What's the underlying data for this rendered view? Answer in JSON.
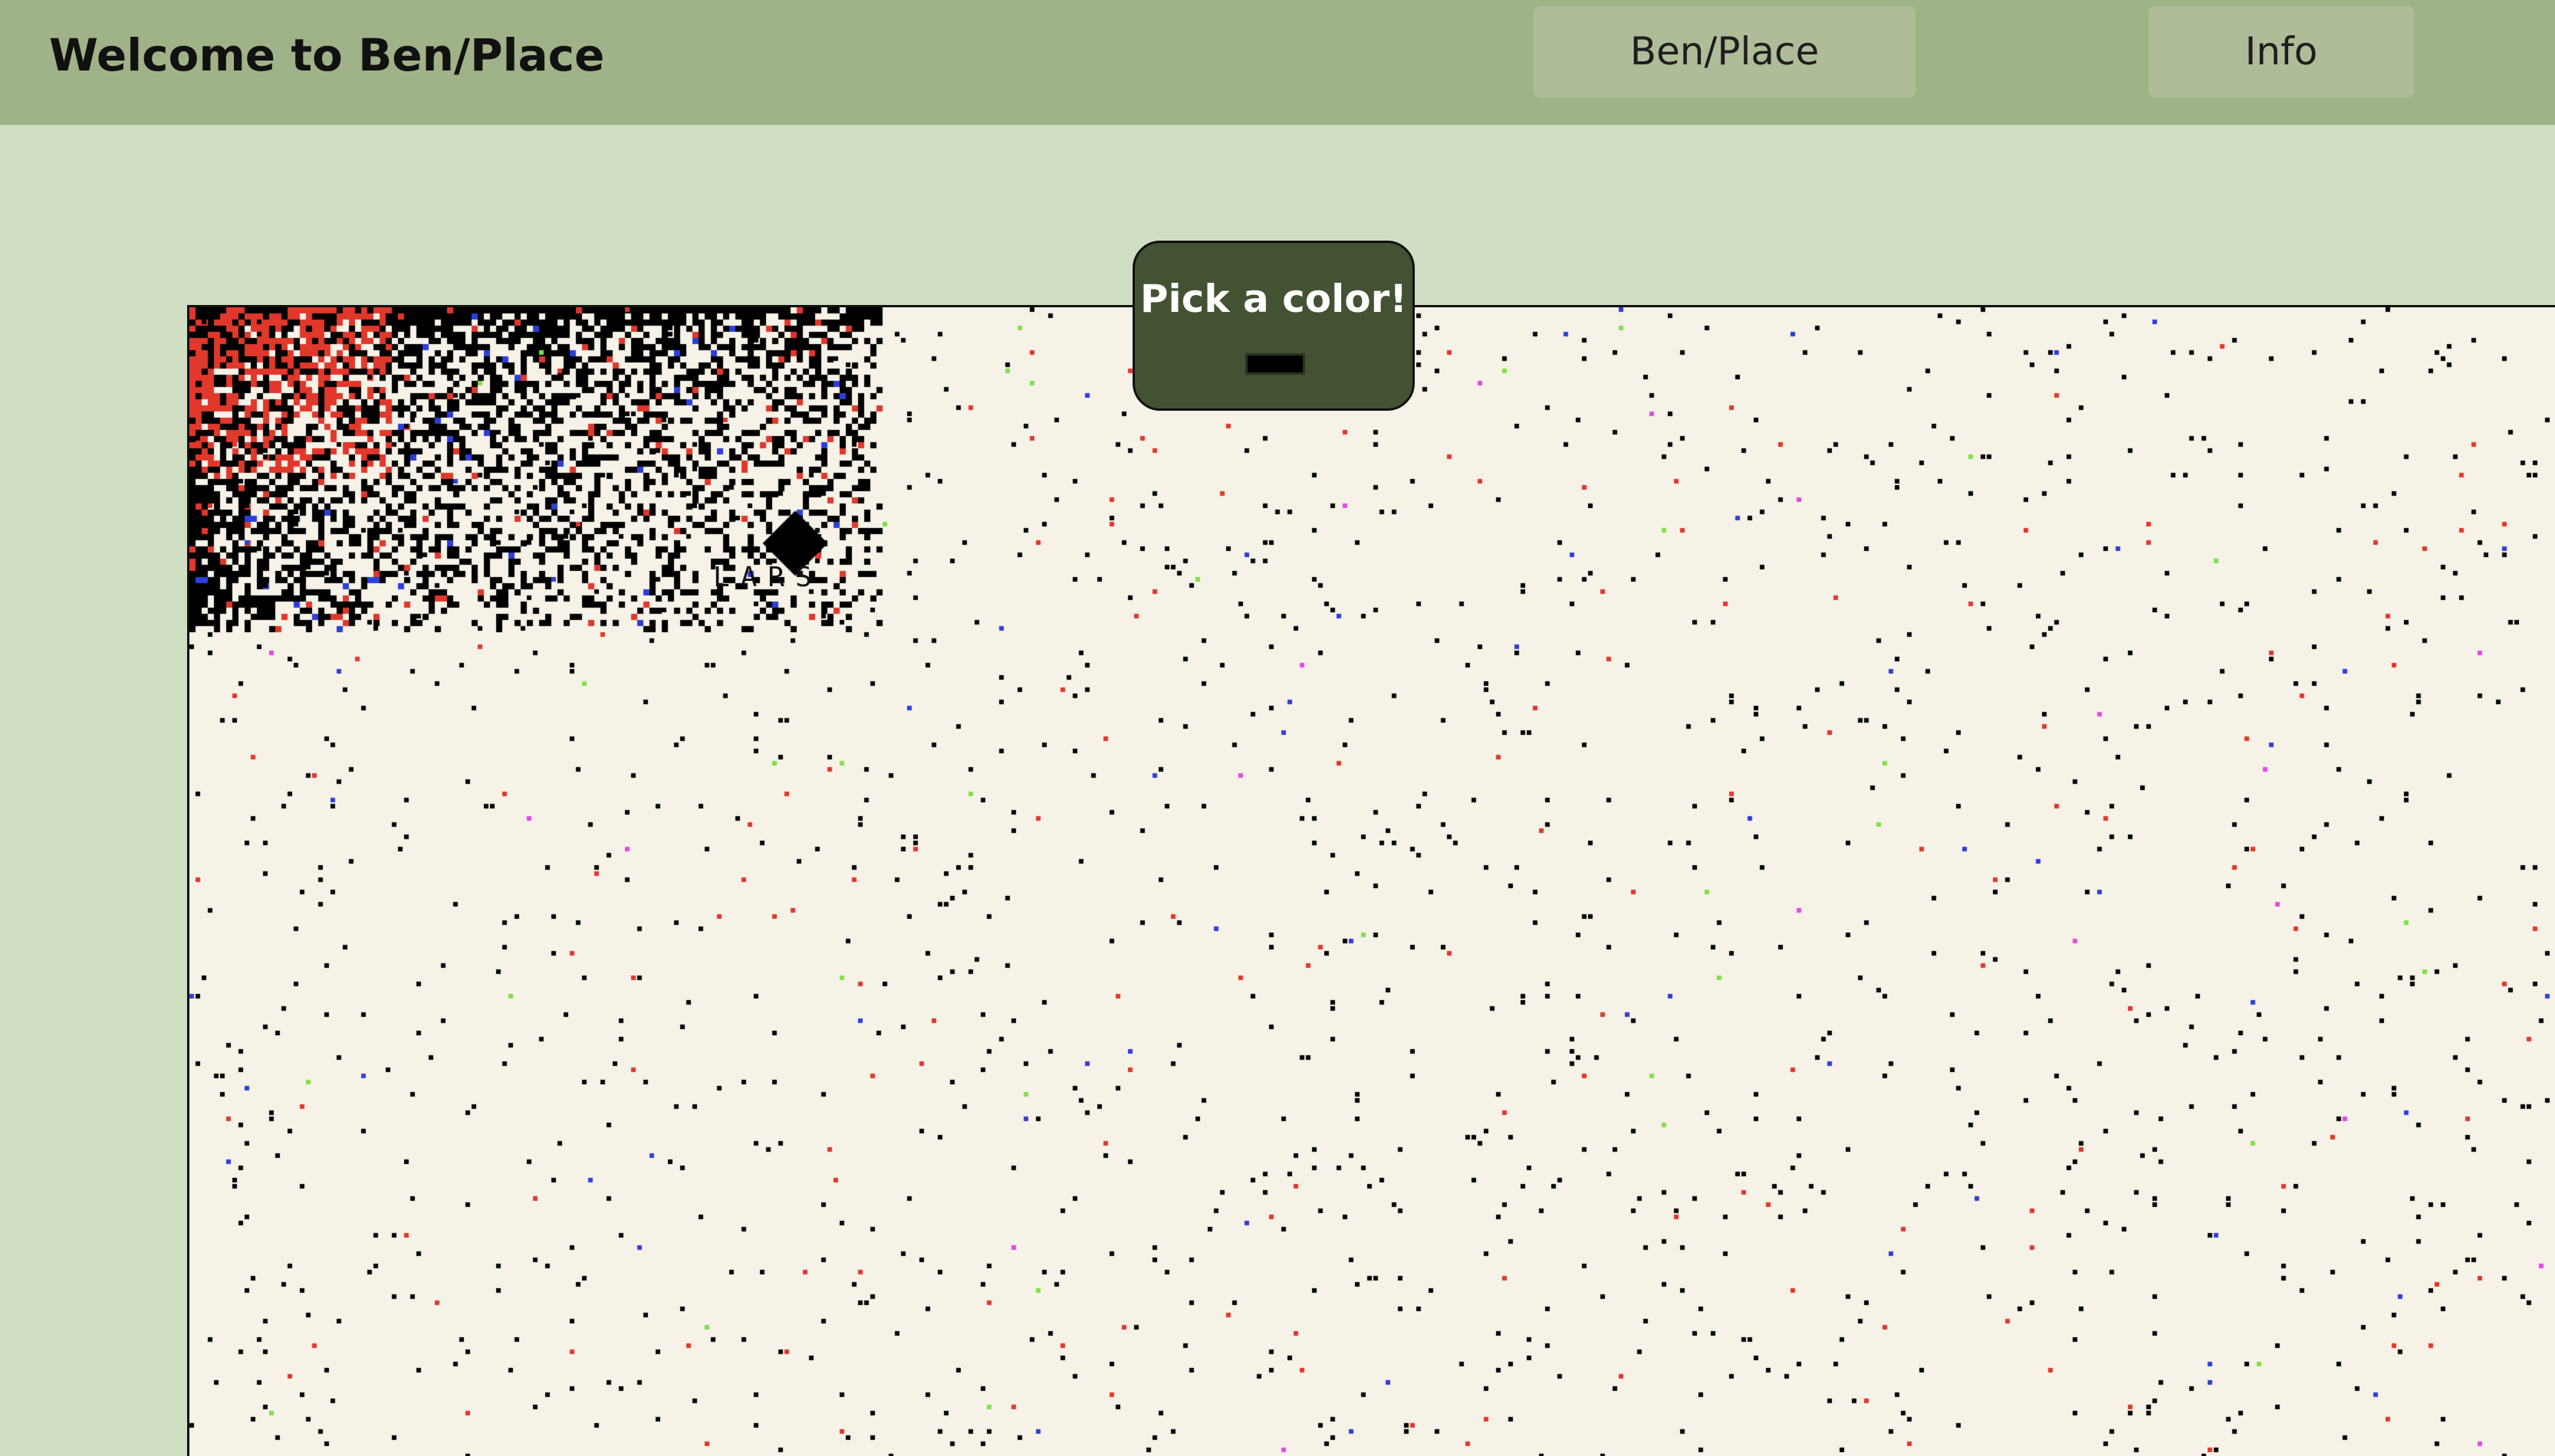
{
  "header": {
    "title": "Welcome to Ben/Place",
    "nav": [
      {
        "label": "Ben/Place"
      },
      {
        "label": "Info"
      }
    ]
  },
  "canvas": {
    "background_color": "#f7f2e8",
    "palette_visible": [
      "#000000",
      "#e0382b",
      "#2b3fd9",
      "#7fe04b",
      "#e04be0",
      "#3fa9e0",
      "#e0c04b"
    ],
    "pixel_word": "LARS"
  },
  "color_picker": {
    "label": "Pick a color!",
    "selected_color": "#000000"
  }
}
